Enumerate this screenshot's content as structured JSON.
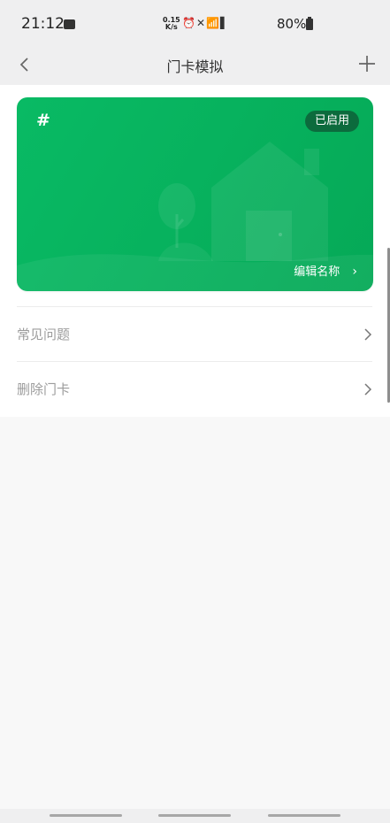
{
  "status_bar": {
    "time": "21:12",
    "speed_value": "0.15",
    "speed_unit": "K/s",
    "signal_text": "4G",
    "battery": "80%"
  },
  "nav": {
    "title": "门卡模拟",
    "back_icon": "chevron-left-icon",
    "add_icon": "plus-icon"
  },
  "card": {
    "symbol": "#",
    "badge": "已启用",
    "edit_label": "编辑名称"
  },
  "menu": {
    "faq": "常见问题",
    "delete": "删除门卡"
  },
  "colors": {
    "card_green": "#09ba64",
    "badge_dark": "#0c6b3d",
    "label_gray": "#9c9c9c"
  }
}
